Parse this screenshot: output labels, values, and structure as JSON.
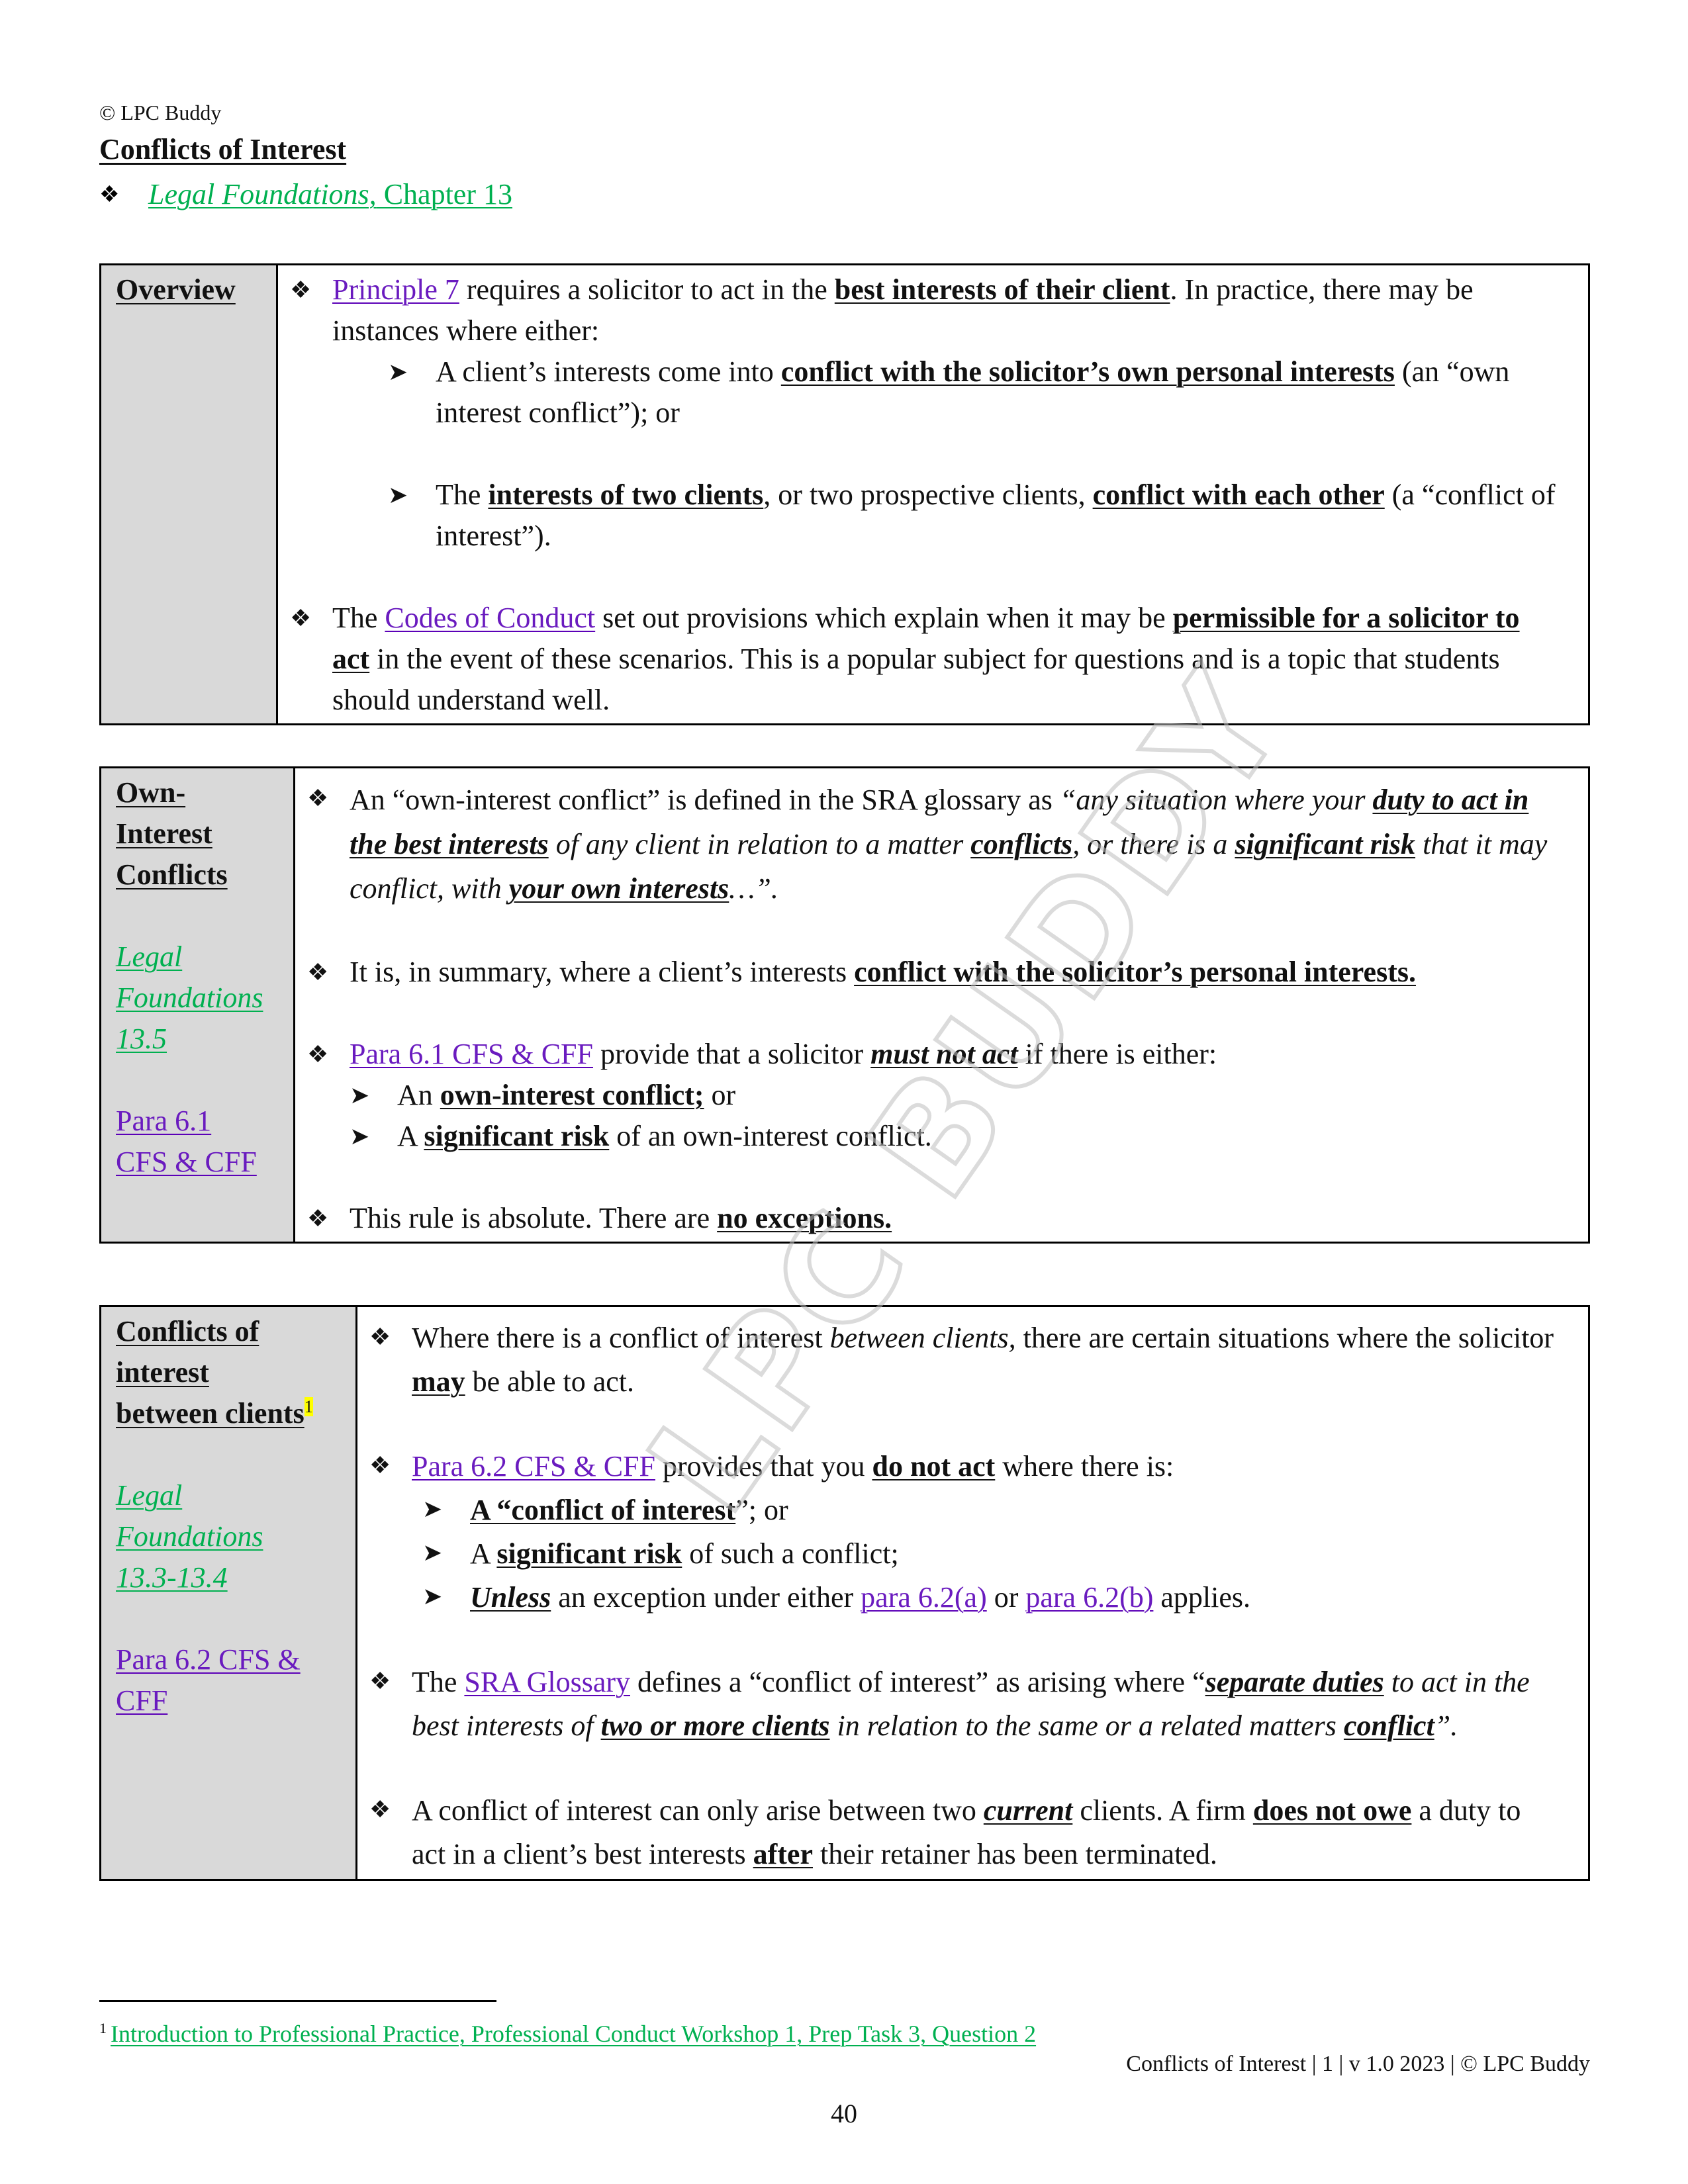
{
  "header": {
    "copyright": "© LPC Buddy",
    "title": "Conflicts of Interest",
    "reference": {
      "book": "Legal Foundations,",
      "chapter": " Chapter 13"
    }
  },
  "colors": {
    "link_green": "#00b050",
    "link_purple": "#6a1bbf",
    "side_bg": "#d9d9d9",
    "footnote_highlight": "#ffff00"
  },
  "watermark": "LPC BUDDY",
  "sections": {
    "overview": {
      "heading": "Overview",
      "b1": {
        "link": "Principle 7",
        "t1": " requires a solicitor to act in the ",
        "bold1": "best interests of their client",
        "t2": ". In practice, there may be instances where either:"
      },
      "s1": {
        "t1": "A client’s interests come into ",
        "bold1": "conflict with the solicitor’s own personal interests",
        "t2": " (an “own interest conflict”); or"
      },
      "s2": {
        "t1": "The ",
        "bold1": "interests of two clients",
        "t2": ", or two prospective clients, ",
        "bold2": "conflict with each other",
        "t3": " (a “conflict of interest”)."
      },
      "b2": {
        "t1": "The ",
        "link": "Codes of Conduct",
        "t2": " set out provisions which explain when it may be ",
        "bold1": "permissible for a solicitor to act",
        "t3": " in the event of these scenarios. This is a popular subject for questions and is a topic that students should understand well."
      }
    },
    "own_interest": {
      "heading_lines": [
        "Own-",
        "Interest",
        "Conflicts"
      ],
      "ref_green": [
        "Legal",
        "Foundations",
        "13.5"
      ],
      "ref_purple": [
        "Para 6.1",
        "CFS & CFF"
      ],
      "b1": {
        "t1": "An “own-interest conflict” is defined in the SRA glossary as ",
        "q1": "“any situation where your ",
        "qb1": "duty to act in the best interests",
        "q2": " of any client in relation to a matter ",
        "qb2": "conflicts",
        "q3": ", or there is a ",
        "qb3": "significant risk",
        "q4": " that it may conflict, with ",
        "qb4": "your own interests",
        "q5": "…”."
      },
      "b2": {
        "t1": "It is, in summary, where a client’s interests ",
        "bold1": "conflict with the solicitor’s personal interests."
      },
      "b3": {
        "link": "Para 6.1 CFS & CFF",
        "t1": " provide that a solicitor ",
        "bi1": "must not act",
        "t2": " if there is either:"
      },
      "s1": {
        "t1": "An ",
        "bold1": "own-interest conflict;",
        "t2": " or"
      },
      "s2": {
        "t1": "A ",
        "bold1": "significant risk",
        "t2": " of an own-interest conflict."
      },
      "b4": {
        "t1": "This rule is absolute. There are ",
        "bold1": "no exceptions."
      }
    },
    "between_clients": {
      "heading_lines": [
        "Conflicts of",
        "interest",
        "between clients"
      ],
      "footnote_ref": "1",
      "ref_green": [
        "Legal",
        "Foundations",
        "13.3-13.4"
      ],
      "ref_purple": [
        "Para 6.2 CFS &",
        "CFF"
      ],
      "b1": {
        "t1": "Where there is a conflict of interest ",
        "it1": "between clients,",
        "t2": " there are certain situations where the solicitor ",
        "bold1": "may",
        "t3": " be able to act."
      },
      "b2": {
        "link": "Para 6.2 CFS & CFF",
        "t1": " provides that you ",
        "bold1": "do not act",
        "t2": " where there is:"
      },
      "s1": {
        "bold1": "A “conflict of interest",
        "t1": "”; or"
      },
      "s2": {
        "t1": "A ",
        "bold1": "significant risk",
        "t2": " of such a conflict;"
      },
      "s3": {
        "bi1": "Unless",
        "t1": " an exception under either ",
        "link1": "para 6.2(a)",
        "t2": " or ",
        "link2": "para 6.2(b)",
        "t3": " applies."
      },
      "b3": {
        "t1": "The ",
        "link": "SRA Glossary",
        "t2": " defines a “conflict of interest” as arising where “",
        "bi1": "separate duties",
        "i1": " to act in the best interests of ",
        "bi2": "two or more clients",
        "i2": " in relation to the same or a related matters ",
        "bi3": "conflict",
        "i3": "”."
      },
      "b4": {
        "t1": "A conflict of interest can only arise between two ",
        "bi1": "current",
        "t2": " clients. A firm ",
        "bold1": "does not owe",
        "t3": " a duty to act in a client’s best interests ",
        "bold2": "after",
        "t4": " their retainer has been terminated."
      }
    }
  },
  "footnote": {
    "number": "1",
    "text": "Introduction to Professional Practice, Professional Conduct Workshop 1, Prep Task 3, Question 2"
  },
  "footer": {
    "info": "Conflicts of Interest | 1 | v 1.0 2023 | © LPC Buddy",
    "page_number": "40"
  }
}
